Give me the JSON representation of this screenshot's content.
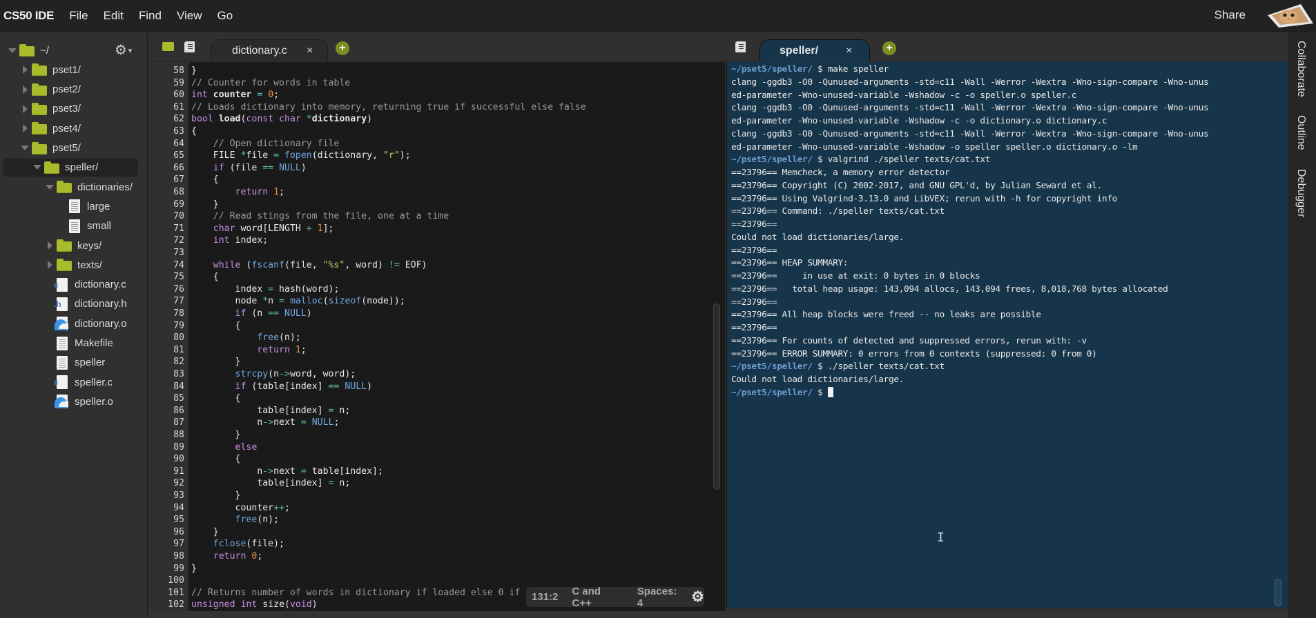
{
  "menubar": {
    "brand": "CS50 IDE",
    "items": [
      "File",
      "Edit",
      "Find",
      "View",
      "Go"
    ],
    "share_label": "Share",
    "avatar_icon": "cat-avatar-icon"
  },
  "sidebar": {
    "settings_icon": "gear-icon",
    "tree": [
      {
        "label": "~/",
        "type": "folder",
        "expanded": true,
        "depth": 0
      },
      {
        "label": "pset1/",
        "type": "folder",
        "expanded": false,
        "depth": 1
      },
      {
        "label": "pset2/",
        "type": "folder",
        "expanded": false,
        "depth": 1
      },
      {
        "label": "pset3/",
        "type": "folder",
        "expanded": false,
        "depth": 1
      },
      {
        "label": "pset4/",
        "type": "folder",
        "expanded": false,
        "depth": 1
      },
      {
        "label": "pset5/",
        "type": "folder",
        "expanded": true,
        "depth": 1
      },
      {
        "label": "speller/",
        "type": "folder",
        "expanded": true,
        "depth": 2,
        "selected": true
      },
      {
        "label": "dictionaries/",
        "type": "folder",
        "expanded": true,
        "depth": 3
      },
      {
        "label": "large",
        "type": "file",
        "depth": 4
      },
      {
        "label": "small",
        "type": "file",
        "depth": 4
      },
      {
        "label": "keys/",
        "type": "folder",
        "expanded": false,
        "depth": 3
      },
      {
        "label": "texts/",
        "type": "folder",
        "expanded": false,
        "depth": 3
      },
      {
        "label": "dictionary.c",
        "type": "c-file",
        "depth": 3
      },
      {
        "label": "dictionary.h",
        "type": "h-file",
        "depth": 3
      },
      {
        "label": "dictionary.o",
        "type": "o-file",
        "depth": 3
      },
      {
        "label": "Makefile",
        "type": "file",
        "depth": 3
      },
      {
        "label": "speller",
        "type": "file",
        "depth": 3
      },
      {
        "label": "speller.c",
        "type": "c-file",
        "depth": 3
      },
      {
        "label": "speller.o",
        "type": "o-file",
        "depth": 3
      }
    ]
  },
  "editor": {
    "tab": {
      "title": "dictionary.c",
      "close": "×"
    },
    "add_tab": "+",
    "lines": [
      {
        "n": "58",
        "html": "}"
      },
      {
        "n": "59",
        "html": "<span class='cm'>// Counter for words in table</span>"
      },
      {
        "n": "60",
        "html": "<span class='tp'>int</span> <span class='bold'>counter</span> <span class='op'>=</span> <span class='num'>0</span>;"
      },
      {
        "n": "61",
        "html": "<span class='cm'>// Loads dictionary into memory, returning true if successful else false</span>"
      },
      {
        "n": "62",
        "html": "<span class='tp'>bool</span> <span class='bold'>load</span>(<span class='kw'>const</span> <span class='tp'>char</span> <span class='op'>*</span><span class='bold'>dictionary</span>)"
      },
      {
        "n": "63",
        "html": "{"
      },
      {
        "n": "64",
        "html": "    <span class='cm'>// Open dictionary file</span>"
      },
      {
        "n": "65",
        "html": "    FILE <span class='op'>*</span>file <span class='op'>=</span> <span class='fn'>fopen</span>(dictionary, <span class='str'>\"r\"</span>);"
      },
      {
        "n": "66",
        "html": "    <span class='kw'>if</span> (file <span class='op'>==</span> <span class='cn'>NULL</span>)"
      },
      {
        "n": "67",
        "html": "    {"
      },
      {
        "n": "68",
        "html": "        <span class='kw'>return</span> <span class='num'>1</span>;"
      },
      {
        "n": "69",
        "html": "    }"
      },
      {
        "n": "70",
        "html": "    <span class='cm'>// Read stings from the file, one at a time</span>"
      },
      {
        "n": "71",
        "html": "    <span class='tp'>char</span> word[LENGTH <span class='op'>+</span> <span class='num'>1</span>];"
      },
      {
        "n": "72",
        "html": "    <span class='tp'>int</span> index;"
      },
      {
        "n": "73",
        "html": ""
      },
      {
        "n": "74",
        "html": "    <span class='kw'>while</span> (<span class='fn'>fscanf</span>(file, <span class='str'>\"%s\"</span>, word) <span class='op'>!=</span> EOF)"
      },
      {
        "n": "75",
        "html": "    {"
      },
      {
        "n": "76",
        "html": "        index <span class='op'>=</span> hash(word);"
      },
      {
        "n": "77",
        "html": "        node <span class='op'>*</span>n <span class='op'>=</span> <span class='fn'>malloc</span>(<span class='fn'>sizeof</span>(node));"
      },
      {
        "n": "78",
        "html": "        <span class='kw'>if</span> (n <span class='op'>==</span> <span class='cn'>NULL</span>)"
      },
      {
        "n": "79",
        "html": "        {"
      },
      {
        "n": "80",
        "html": "            <span class='fn'>free</span>(n);"
      },
      {
        "n": "81",
        "html": "            <span class='kw'>return</span> <span class='num'>1</span>;"
      },
      {
        "n": "82",
        "html": "        }"
      },
      {
        "n": "83",
        "html": "        <span class='fn'>strcpy</span>(n<span class='op'>-&gt;</span>word, word);"
      },
      {
        "n": "84",
        "html": "        <span class='kw'>if</span> (table[index] <span class='op'>==</span> <span class='cn'>NULL</span>)"
      },
      {
        "n": "85",
        "html": "        {"
      },
      {
        "n": "86",
        "html": "            table[index] <span class='op'>=</span> n;"
      },
      {
        "n": "87",
        "html": "            n<span class='op'>-&gt;</span>next <span class='op'>=</span> <span class='cn'>NULL</span>;"
      },
      {
        "n": "88",
        "html": "        }"
      },
      {
        "n": "89",
        "html": "        <span class='kw'>else</span>"
      },
      {
        "n": "90",
        "html": "        {"
      },
      {
        "n": "91",
        "html": "            n<span class='op'>-&gt;</span>next <span class='op'>=</span> table[index];"
      },
      {
        "n": "92",
        "html": "            table[index] <span class='op'>=</span> n;"
      },
      {
        "n": "93",
        "html": "        }"
      },
      {
        "n": "94",
        "html": "        counter<span class='op'>++</span>;"
      },
      {
        "n": "95",
        "html": "        <span class='fn'>free</span>(n);"
      },
      {
        "n": "96",
        "html": "    }"
      },
      {
        "n": "97",
        "html": "    <span class='fn'>fclose</span>(file);"
      },
      {
        "n": "98",
        "html": "    <span class='kw'>return</span> <span class='num'>0</span>;"
      },
      {
        "n": "99",
        "html": "}"
      },
      {
        "n": "100",
        "html": ""
      },
      {
        "n": "101",
        "html": "<span class='cm'>// Returns number of words in dictionary if loaded else 0 if not yet loaded</span>"
      },
      {
        "n": "102",
        "html": "<span class='tp'>unsigned</span> <span class='tp'>int</span> size(<span class='tp'>void</span>)"
      }
    ],
    "status": {
      "position": "131:2",
      "language": "C and C++",
      "indent": "Spaces: 4"
    }
  },
  "terminal": {
    "tab": {
      "title": "speller/",
      "close": "×"
    },
    "add_tab": "+",
    "lines": [
      {
        "prompt": "~/pset5/speller/",
        "text": " $ make speller"
      },
      {
        "text": "clang -ggdb3 -O0 -Qunused-arguments -std=c11 -Wall -Werror -Wextra -Wno-sign-compare -Wno-unus"
      },
      {
        "text": "ed-parameter -Wno-unused-variable -Wshadow -c -o speller.o speller.c"
      },
      {
        "text": "clang -ggdb3 -O0 -Qunused-arguments -std=c11 -Wall -Werror -Wextra -Wno-sign-compare -Wno-unus"
      },
      {
        "text": "ed-parameter -Wno-unused-variable -Wshadow -c -o dictionary.o dictionary.c"
      },
      {
        "text": "clang -ggdb3 -O0 -Qunused-arguments -std=c11 -Wall -Werror -Wextra -Wno-sign-compare -Wno-unus"
      },
      {
        "text": "ed-parameter -Wno-unused-variable -Wshadow -o speller speller.o dictionary.o -lm"
      },
      {
        "prompt": "~/pset5/speller/",
        "text": " $ valgrind ./speller texts/cat.txt"
      },
      {
        "text": "==23796== Memcheck, a memory error detector"
      },
      {
        "text": "==23796== Copyright (C) 2002-2017, and GNU GPL'd, by Julian Seward et al."
      },
      {
        "text": "==23796== Using Valgrind-3.13.0 and LibVEX; rerun with -h for copyright info"
      },
      {
        "text": "==23796== Command: ./speller texts/cat.txt"
      },
      {
        "text": "==23796=="
      },
      {
        "text": "Could not load dictionaries/large."
      },
      {
        "text": "==23796=="
      },
      {
        "text": "==23796== HEAP SUMMARY:"
      },
      {
        "text": "==23796==     in use at exit: 0 bytes in 0 blocks"
      },
      {
        "text": "==23796==   total heap usage: 143,094 allocs, 143,094 frees, 8,018,768 bytes allocated"
      },
      {
        "text": "==23796=="
      },
      {
        "text": "==23796== All heap blocks were freed -- no leaks are possible"
      },
      {
        "text": "==23796=="
      },
      {
        "text": "==23796== For counts of detected and suppressed errors, rerun with: -v"
      },
      {
        "text": "==23796== ERROR SUMMARY: 0 errors from 0 contexts (suppressed: 0 from 0)"
      },
      {
        "prompt": "~/pset5/speller/",
        "text": " $ ./speller texts/cat.txt"
      },
      {
        "text": "Could not load dictionaries/large."
      },
      {
        "prompt": "~/pset5/speller/",
        "text": " $ ",
        "cursor": true
      }
    ]
  },
  "right_dock": {
    "tabs": [
      "Collaborate",
      "Outline",
      "Debugger"
    ]
  },
  "colors": {
    "folder": "#a9bb2a",
    "terminal_bg": "#17354a",
    "editor_bg": "#1a1a1a",
    "prompt": "#6c9bd2",
    "add_button": "#7d8f22"
  }
}
